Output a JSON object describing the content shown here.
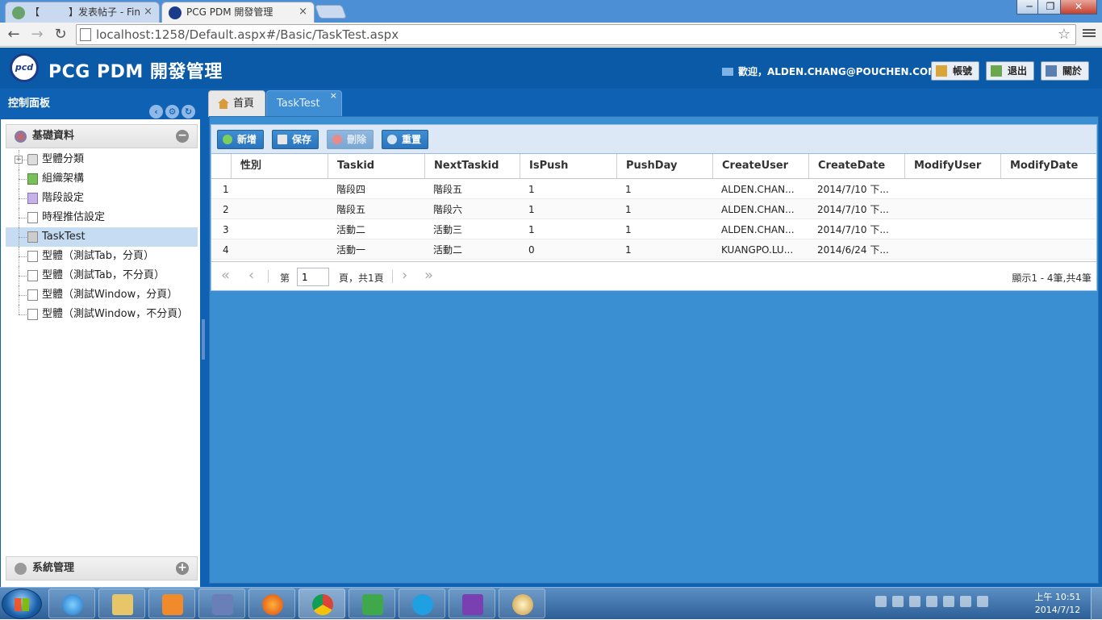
{
  "browser": {
    "tabs": [
      {
        "title": "【　　　】发表帖子 - Fin",
        "active": false
      },
      {
        "title": "PCG PDM 開發管理",
        "active": true
      }
    ],
    "tab_close": "×",
    "url": "localhost:1258/Default.aspx#/Basic/TaskTest.aspx",
    "window_controls": {
      "minimize": "─",
      "maximize": "❐",
      "close": "✕"
    }
  },
  "app": {
    "logo_text": "pcd",
    "title": "PCG PDM 開發管理",
    "welcome": "歡迎，ALDEN.CHANG@POUCHEN.COM",
    "header_buttons": {
      "account": "帳號",
      "logout": "退出",
      "about": "關於"
    }
  },
  "sidebar": {
    "title": "控制面板",
    "sections": {
      "basic": {
        "label": "基礎資料",
        "toggle": "−"
      },
      "system": {
        "label": "系統管理",
        "toggle": "+"
      }
    },
    "tree": [
      {
        "label": "型體分類",
        "expandable": true
      },
      {
        "label": "組織架構"
      },
      {
        "label": "階段設定"
      },
      {
        "label": "時程推估設定"
      },
      {
        "label": "TaskTest",
        "selected": true
      },
      {
        "label": "型體（測試Tab，分頁）"
      },
      {
        "label": "型體（測試Tab，不分頁）"
      },
      {
        "label": "型體（測試Window，分頁）"
      },
      {
        "label": "型體（測試Window，不分頁）"
      }
    ]
  },
  "main_tabs": {
    "home": "首頁",
    "current": "TaskTest",
    "close": "×"
  },
  "grid": {
    "toolbar": {
      "add": "新增",
      "save": "保存",
      "delete": "刪除",
      "reset": "重置"
    },
    "columns": [
      "性別",
      "Taskid",
      "NextTaskid",
      "IsPush",
      "PushDay",
      "CreateUser",
      "CreateDate",
      "ModifyUser",
      "ModifyDate"
    ],
    "rows": [
      {
        "n": "1",
        "cells": [
          "",
          "階段四",
          "階段五",
          "1",
          "1",
          "ALDEN.CHAN...",
          "2014/7/10 下...",
          "",
          ""
        ]
      },
      {
        "n": "2",
        "cells": [
          "",
          "階段五",
          "階段六",
          "1",
          "1",
          "ALDEN.CHAN...",
          "2014/7/10 下...",
          "",
          ""
        ]
      },
      {
        "n": "3",
        "cells": [
          "",
          "活動二",
          "活動三",
          "1",
          "1",
          "ALDEN.CHAN...",
          "2014/7/10 下...",
          "",
          ""
        ]
      },
      {
        "n": "4",
        "cells": [
          "",
          "活動一",
          "活動二",
          "0",
          "1",
          "KUANGPO.LU...",
          "2014/6/24 下...",
          "",
          ""
        ]
      }
    ],
    "pager": {
      "page_prefix": "第",
      "page_value": "1",
      "page_suffix": "頁，共1頁",
      "summary": "顯示1 - 4筆,共4筆"
    }
  },
  "taskbar": {
    "clock_time": "上午 10:51",
    "clock_date": "2014/7/12"
  }
}
